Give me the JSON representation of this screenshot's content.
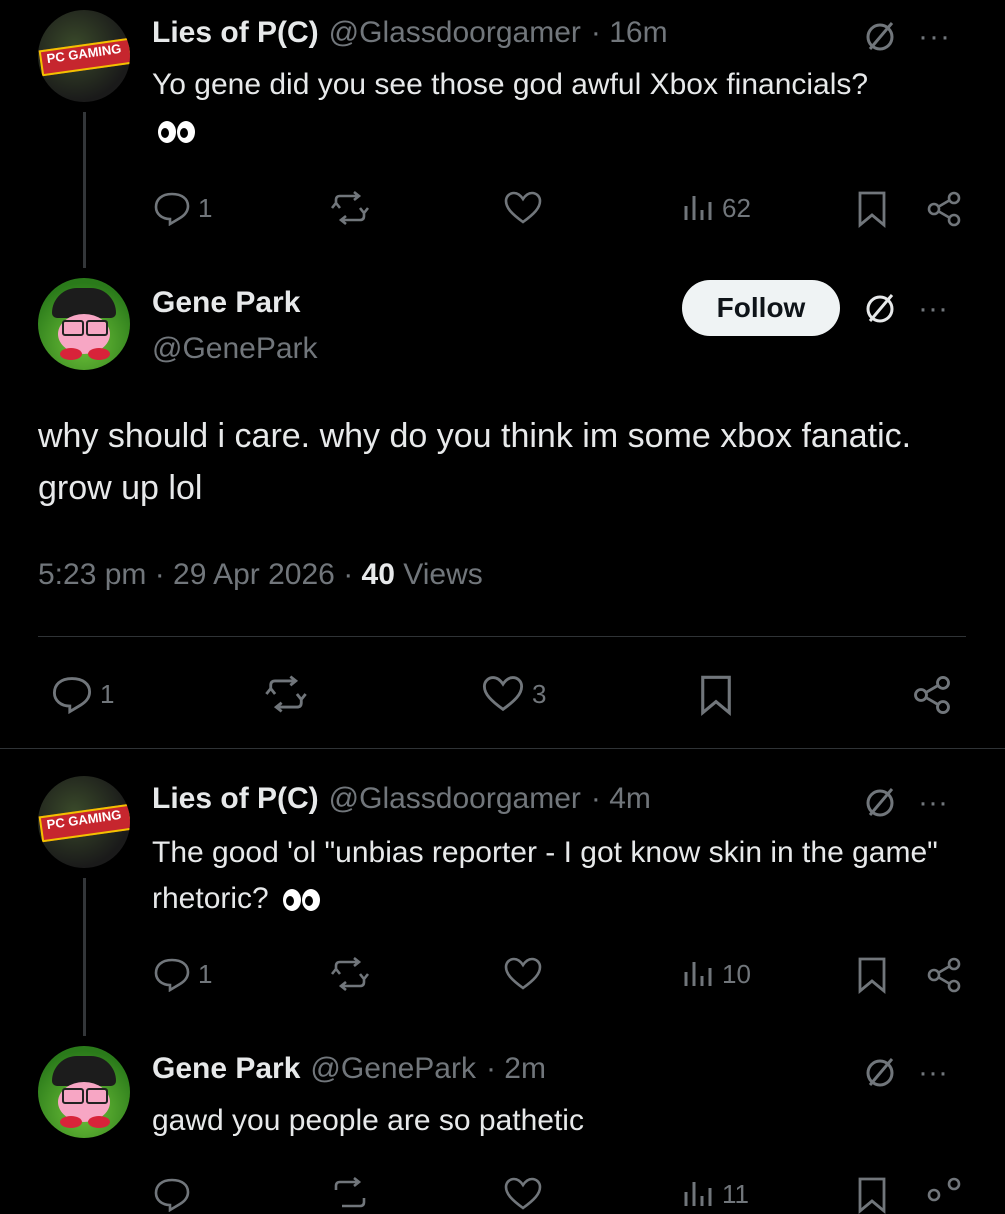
{
  "tweets": [
    {
      "name": "Lies of P(C)",
      "handle": "@Glassdoorgamer",
      "time": "· 16m",
      "text": "Yo gene did you see those god awful Xbox financials?",
      "emoji": "eyes",
      "replies": "1",
      "views": "62"
    },
    {
      "name": "Gene Park",
      "handle": "@GenePark",
      "follow_label": "Follow",
      "text": "why should i care. why do you think im some xbox fanatic. grow up lol",
      "timestamp": "5:23 pm · 29 Apr 2026 ·",
      "views_count": "40",
      "views_label": "Views",
      "replies": "1",
      "likes": "3"
    },
    {
      "name": "Lies of P(C)",
      "handle": "@Glassdoorgamer",
      "time": "· 4m",
      "text": "The good 'ol \"unbias reporter - I got know skin in the game\" rhetoric?",
      "emoji": "eyes",
      "replies": "1",
      "views": "10"
    },
    {
      "name": "Gene Park",
      "handle": "@GenePark",
      "time": "· 2m",
      "text": "gawd you people are so pathetic",
      "views": "11"
    }
  ],
  "avatar_pc_label": "PC GAMING",
  "colors": {
    "background": "#000000",
    "text": "#e7e9ea",
    "muted": "#71767b",
    "divider": "#2f3336",
    "follow_bg": "#eff3f4"
  }
}
